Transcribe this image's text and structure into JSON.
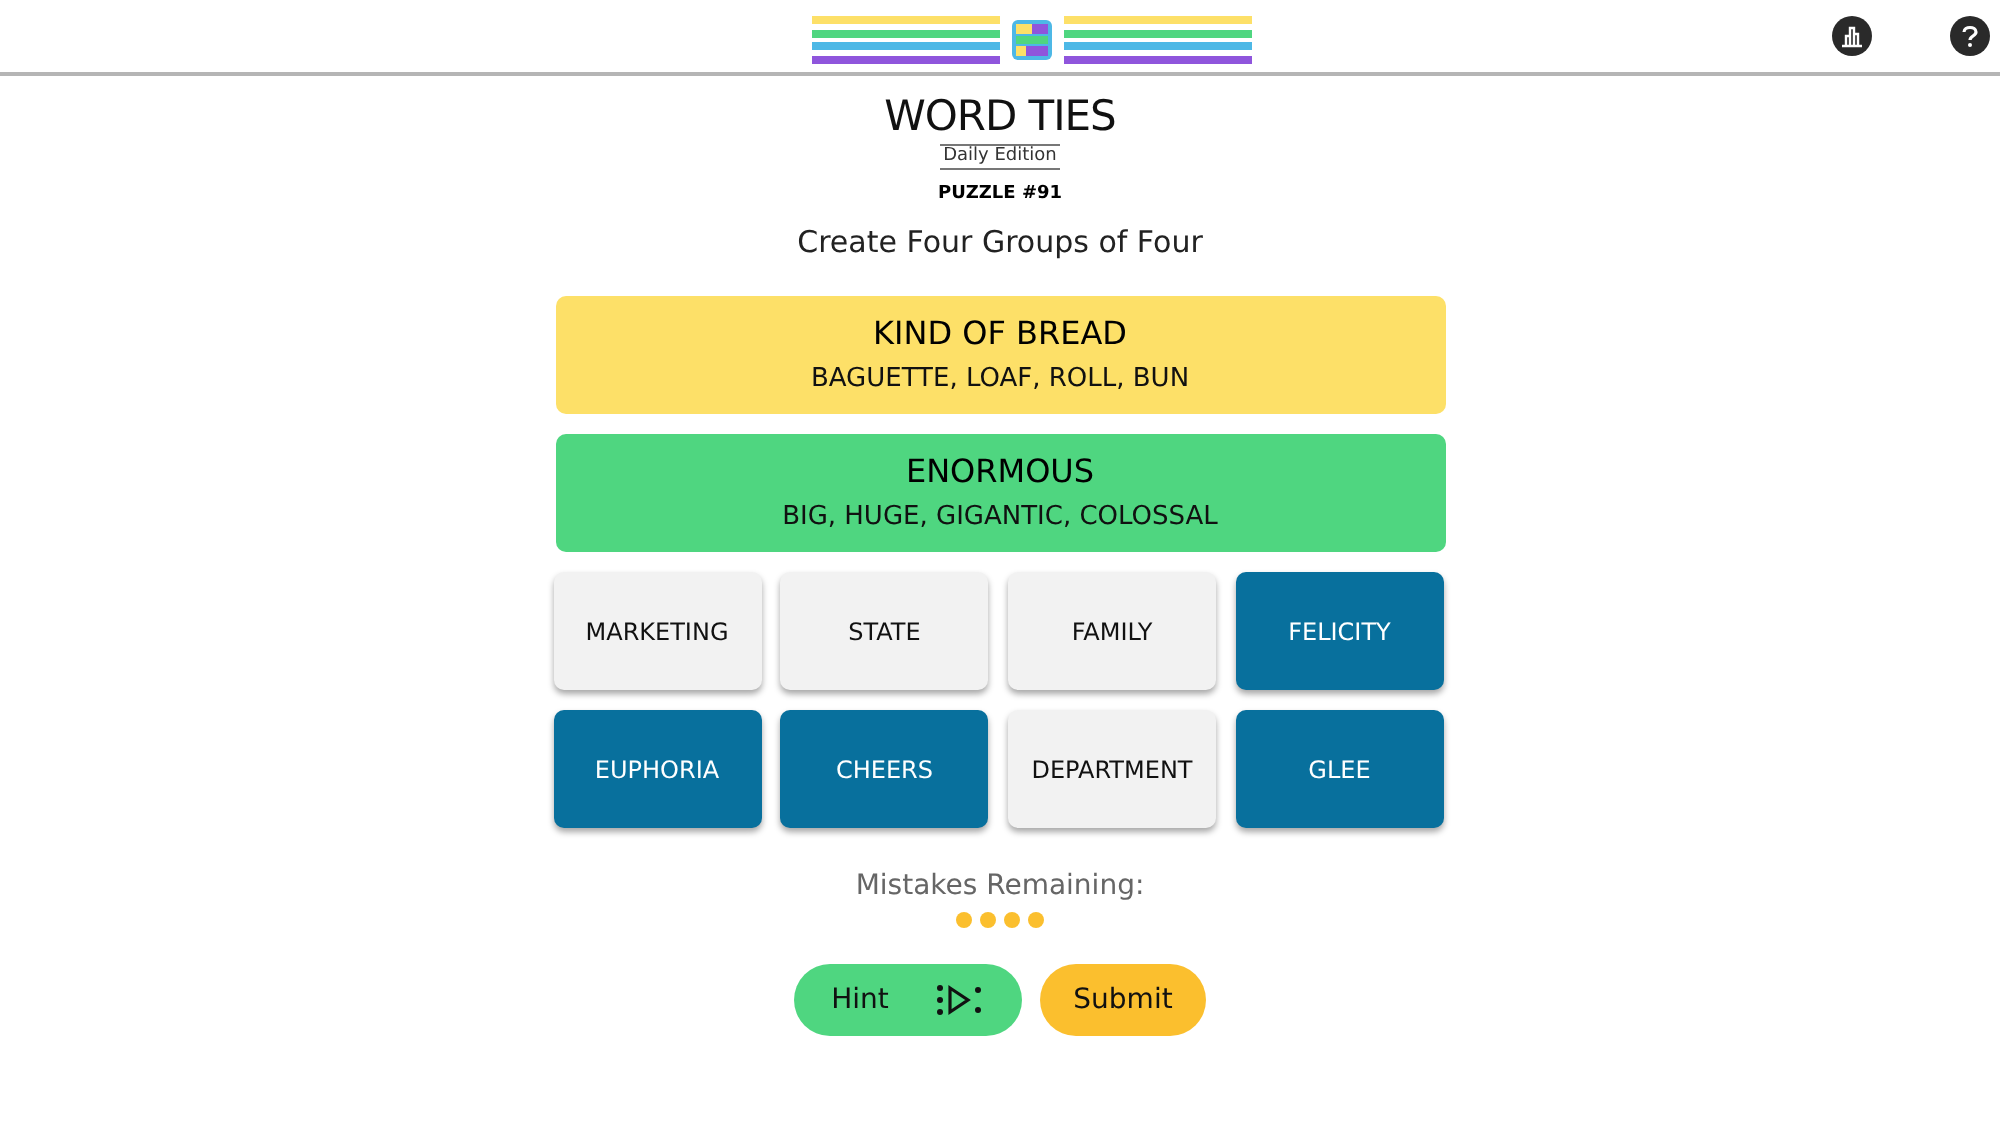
{
  "title": "WORD TIES",
  "edition": "Daily Edition",
  "puzzle": "PUZZLE #91",
  "instructions": "Create Four Groups of Four",
  "solved_groups": [
    {
      "name": "KIND OF BREAD",
      "words": "BAGUETTE, LOAF, ROLL, BUN",
      "color": "#fde068"
    },
    {
      "name": "ENORMOUS",
      "words": "BIG, HUGE, GIGANTIC, COLOSSAL",
      "color": "#4fd680"
    }
  ],
  "tiles": [
    {
      "word": "MARKETING",
      "selected": false
    },
    {
      "word": "STATE",
      "selected": false
    },
    {
      "word": "FAMILY",
      "selected": false
    },
    {
      "word": "FELICITY",
      "selected": true
    },
    {
      "word": "EUPHORIA",
      "selected": true
    },
    {
      "word": "CHEERS",
      "selected": true
    },
    {
      "word": "DEPARTMENT",
      "selected": false
    },
    {
      "word": "GLEE",
      "selected": true
    }
  ],
  "mistakes_label": "Mistakes Remaining:",
  "mistake_dots": [
    {
      "filled": true
    },
    {
      "filled": true
    },
    {
      "filled": true
    },
    {
      "filled": true
    }
  ],
  "buttons": [
    {
      "kind": "hint",
      "label": "Hint"
    },
    {
      "kind": "submit",
      "label": "Submit"
    }
  ]
}
